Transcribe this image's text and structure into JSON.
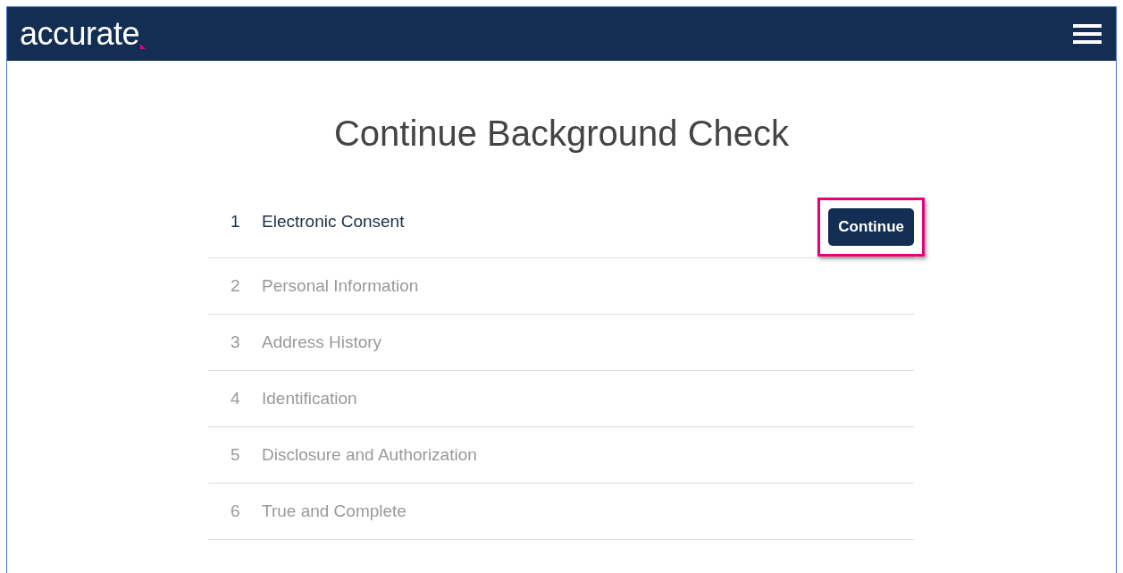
{
  "header": {
    "logo": "accurate"
  },
  "title": "Continue Background Check",
  "steps": [
    {
      "number": "1",
      "label": "Electronic Consent",
      "active": true,
      "button": {
        "label": "Continue",
        "highlighted": true
      }
    },
    {
      "number": "2",
      "label": "Personal Information",
      "active": false
    },
    {
      "number": "3",
      "label": "Address History",
      "active": false
    },
    {
      "number": "4",
      "label": "Identification",
      "active": false
    },
    {
      "number": "5",
      "label": "Disclosure and Authorization",
      "active": false
    },
    {
      "number": "6",
      "label": "True and Complete",
      "active": false
    }
  ]
}
